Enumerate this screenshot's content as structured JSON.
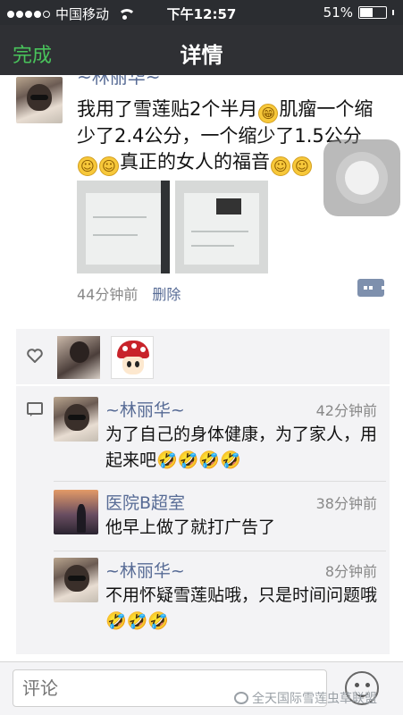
{
  "status_bar": {
    "carrier": "中国移动",
    "time": "下午12:57",
    "battery": "51%",
    "battery_level": 0.51
  },
  "nav": {
    "back_label": "完成",
    "title": "详情"
  },
  "post": {
    "author": "~林丽华~",
    "text_parts": [
      "我用了雪莲贴2个半月",
      "肌瘤一个缩少了2.4公分，一个缩少了1.5公分",
      "真正的女人的福音"
    ],
    "time": "44分钟前",
    "delete_label": "删除",
    "emoji_grin": "😁",
    "emoji_smile": "☺"
  },
  "comments": [
    {
      "author": "~林丽华~",
      "time": "42分钟前",
      "text": "为了自己的身体健康，为了家人，用起来吧",
      "emoji": "🤣🤣🤣🤣"
    },
    {
      "author": "医院B超室",
      "time": "38分钟前",
      "text": "他早上做了就打广告了",
      "emoji": ""
    },
    {
      "author": "~林丽华~",
      "time": "8分钟前",
      "text": "不用怀疑雪莲贴哦，只是时间问题哦",
      "emoji": "🤣🤣🤣"
    }
  ],
  "input": {
    "placeholder": "评论"
  },
  "watermark": "全天国际雪莲虫草联盟"
}
